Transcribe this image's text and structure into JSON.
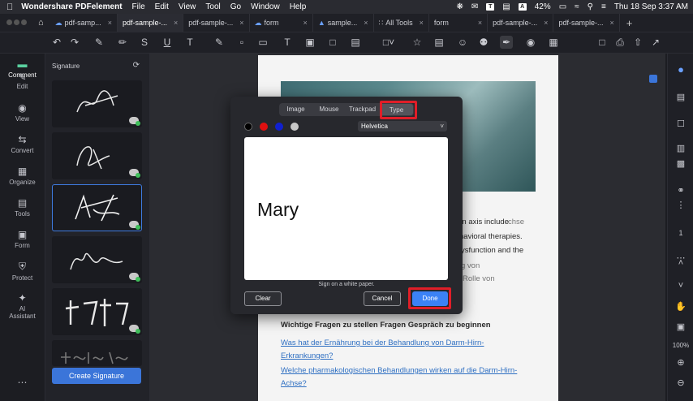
{
  "menubar": {
    "app": "Wondershare PDFelement",
    "items": [
      "File",
      "Edit",
      "View",
      "Tool",
      "Go",
      "Window",
      "Help"
    ],
    "status": {
      "t_label": "T",
      "a_label": "A",
      "battery": "42%",
      "datetime": "Thu 18 Sep  3:37 AM"
    }
  },
  "tabs": [
    {
      "label": "pdf-samp..."
    },
    {
      "label": "pdf-sample-..."
    },
    {
      "label": "pdf-sample-..."
    },
    {
      "label": "form"
    },
    {
      "label": "sample..."
    },
    {
      "label": "All Tools"
    },
    {
      "label": "form"
    },
    {
      "label": "pdf-sample-..."
    },
    {
      "label": "pdf-sample-..."
    }
  ],
  "rail": [
    {
      "label": "Comment"
    },
    {
      "label": "Edit"
    },
    {
      "label": "View"
    },
    {
      "label": "Convert"
    },
    {
      "label": "Organize"
    },
    {
      "label": "Tools"
    },
    {
      "label": "Form"
    },
    {
      "label": "Protect"
    },
    {
      "label": "AI Assistant"
    }
  ],
  "panel": {
    "title": "Signature",
    "create_label": "Create Signature"
  },
  "dialog": {
    "tabs": [
      "Image",
      "Mouse",
      "Trackpad",
      "Type"
    ],
    "selected_tab": "Type",
    "font": "Helvetica",
    "typed_text": "Mary",
    "hint": "Sign on a white paper.",
    "clear_label": "Clear",
    "cancel_label": "Cancel",
    "done_label": "Done",
    "colors": [
      "#000000",
      "#e01010",
      "#1020d0",
      "#c8c8c8"
    ],
    "highlight_color": "#e01e28"
  },
  "doc": {
    "right_frag1": "ain axis include",
    "right_gray1": "chse",
    "right_frag2": "havioral therapies.",
    "right_frag3": "ysfunction and the",
    "right_gray2": "g von",
    "right_gray3": "Rolle von",
    "line1": "Wichtige Fragen zu stellen Fragen Gespräch zu beginnen",
    "line2": "Was hat der Ernährung bei der Behandlung von Darm-Hirn-",
    "line3": "Erkrankungen?",
    "line4": "Welche pharmakologischen Behandlungen wirken auf die Darm-Hirn-",
    "line5": "Achse?"
  },
  "right_rail": {
    "page_num": "1",
    "zoom": "100%"
  },
  "accent": "#3b75d9"
}
